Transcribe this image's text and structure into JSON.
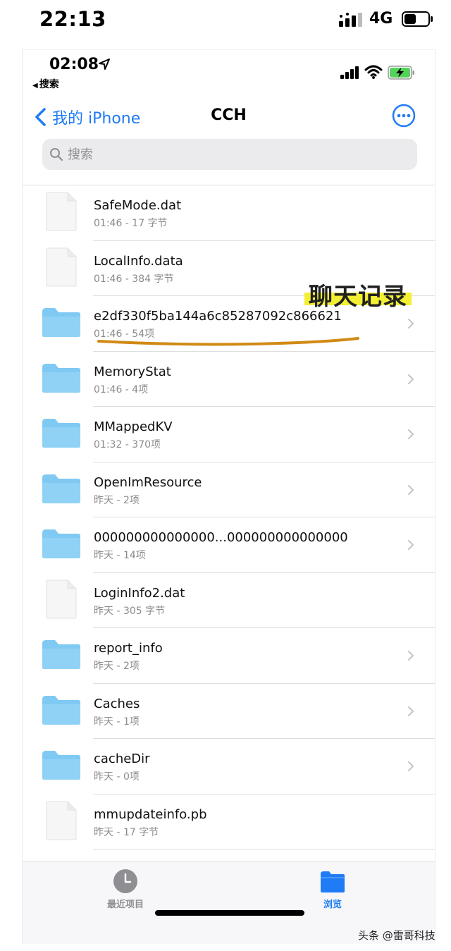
{
  "outer_status": {
    "time": "22:13",
    "network": "4G"
  },
  "inner_status": {
    "time": "02:08",
    "back_app": "搜索"
  },
  "nav": {
    "back_label": "我的 iPhone",
    "title": "CCH"
  },
  "search": {
    "placeholder": "搜索"
  },
  "annotation": {
    "text": "聊天记录"
  },
  "files": [
    {
      "name": "SafeMode.dat",
      "meta": "01:46 - 17 字节",
      "type": "file"
    },
    {
      "name": "LocalInfo.data",
      "meta": "01:46 - 384 字节",
      "type": "file"
    },
    {
      "name": "e2df330f5ba144a6c85287092c866621",
      "meta": "01:46 - 54项",
      "type": "folder"
    },
    {
      "name": "MemoryStat",
      "meta": "01:46 - 4项",
      "type": "folder"
    },
    {
      "name": "MMappedKV",
      "meta": "01:32 - 370项",
      "type": "folder"
    },
    {
      "name": "OpenImResource",
      "meta": "昨天 - 2项",
      "type": "folder"
    },
    {
      "name": "000000000000000...000000000000000",
      "meta": "昨天 - 14项",
      "type": "folder"
    },
    {
      "name": "LoginInfo2.dat",
      "meta": "昨天 - 305 字节",
      "type": "file"
    },
    {
      "name": "report_info",
      "meta": "昨天 - 2项",
      "type": "folder"
    },
    {
      "name": "Caches",
      "meta": "昨天 - 1项",
      "type": "folder"
    },
    {
      "name": "cacheDir",
      "meta": "昨天 - 0项",
      "type": "folder"
    },
    {
      "name": "mmupdateinfo.pb",
      "meta": "昨天 - 17 字节",
      "type": "file"
    }
  ],
  "tabbar": {
    "recent_label": "最近项目",
    "browse_label": "浏览"
  },
  "watermark": "头条 @雷哥科技",
  "colors": {
    "accent": "#1f7bf6",
    "folder": "#7fc9f3",
    "highlight": "#f2ef34",
    "underline": "#d08a14"
  }
}
